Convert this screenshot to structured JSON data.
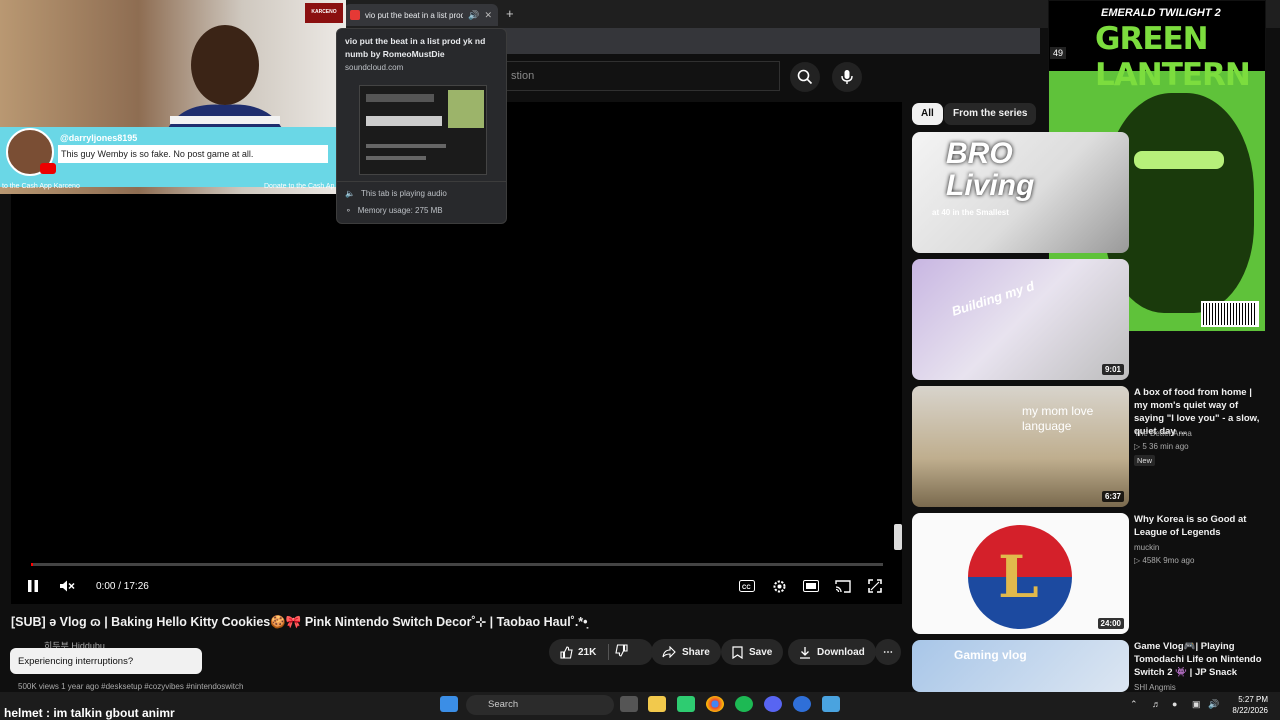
{
  "browser": {
    "tab_title": "vio put the beat in a list prod",
    "new_tab": "+",
    "popup": {
      "title": "vio put the beat in a list prod yk nd numb by RomeoMustDie",
      "url": "soundcloud.com",
      "audio": "This tab is playing audio",
      "memory": "Memory usage: 275 MB"
    }
  },
  "youtube": {
    "search_placeholder": "stion",
    "player": {
      "time": "0:00 / 17:26",
      "progress_percent": 0
    },
    "video": {
      "title": "[SUB] ə Vlog ɷ | Baking Hello Kitty Cookies🍪🎀 Pink Nintendo Switch Decor˚⊹ | Taobao Haul˚.*•̣",
      "channel": "히두부 Hiddubu",
      "views": "500K views  1 year ago  #desksetup #cozyvibes #nintendoswitch",
      "likes": "21K",
      "share": "Share",
      "save": "Save",
      "download": "Download"
    },
    "toast": "Experiencing interruptions?",
    "chips": [
      "All",
      "From the series"
    ],
    "recommendations": [
      {
        "title": "",
        "channel": "",
        "meta": "",
        "duration": "",
        "thumb_text": "BRO Living",
        "thumb_sub": "at 40 in the Smallest"
      },
      {
        "title": "",
        "channel": "",
        "meta": "",
        "duration": "9:01",
        "thumb_text": "Building my d"
      },
      {
        "title": "A box of food from home | my mom's quiet way of saying \"I love you\" - a slow, quiet day ...",
        "channel": "The Better Anna",
        "meta": "▷ 5  36 min ago",
        "badge": "New",
        "duration": "6:37",
        "thumb_text": "my mom love language"
      },
      {
        "title": "Why Korea is so Good at League of Legends",
        "channel": "muckin",
        "meta": "▷ 458K  9mo ago",
        "duration": "24:00",
        "thumb_text": "L"
      },
      {
        "title": "Game Vlog🎮| Playing Tomodachi Life on Nintendo Switch 2 👾 | JP Snack Haul...",
        "channel": "SHI Angmis",
        "meta": "",
        "duration": "",
        "thumb_text": "Gaming vlog"
      }
    ]
  },
  "stream_overlay": {
    "chat_user": "@darryljones8195",
    "chat_message": "This guy Wemby is so fake. No post game at all.",
    "cash_left": "to the Cash App Karceno",
    "cash_right": "Donate to the Cash Ap",
    "logo_text": "KARCENO",
    "ticker": "helmet : im talkin gbout animr",
    "comic": {
      "series": "EMERALD TWILIGHT 2",
      "title": "GREEN LANTERN",
      "issue": "49"
    }
  },
  "taskbar": {
    "search": "Search",
    "time": "5:27 PM",
    "date": "8/22/2026"
  },
  "colors": {
    "accent": "#ff0000",
    "background": "#0f0f0f",
    "chat_bg": "#6ad7e6",
    "comic_green": "#5fc23a"
  }
}
